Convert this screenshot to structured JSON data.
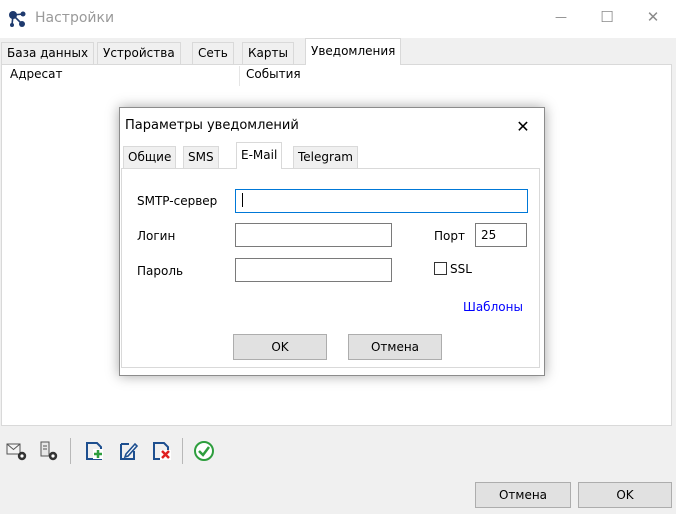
{
  "window": {
    "title": "Настройки",
    "controls": {
      "minimize": "—",
      "maximize": "☐",
      "close": "✕"
    }
  },
  "tabs": [
    {
      "label": "База данных"
    },
    {
      "label": "Устройства"
    },
    {
      "label": "Сеть"
    },
    {
      "label": "Карты"
    },
    {
      "label": "Уведомления",
      "active": true
    }
  ],
  "list": {
    "columns": [
      "Адресат",
      "События"
    ]
  },
  "toolbar": {
    "icons": [
      "mail-settings-icon",
      "device-settings-icon",
      "add-icon",
      "edit-icon",
      "delete-icon",
      "check-icon"
    ]
  },
  "footer": {
    "cancel_label": "Отмена",
    "ok_label": "OK"
  },
  "dialog": {
    "title": "Параметры уведомлений",
    "close": "✕",
    "tabs": [
      {
        "label": "Общие"
      },
      {
        "label": "SMS"
      },
      {
        "label": "E-Mail",
        "active": true
      },
      {
        "label": "Telegram"
      }
    ],
    "fields": {
      "smtp_label": "SMTP-сервер",
      "smtp_value": "",
      "login_label": "Логин",
      "login_value": "",
      "password_label": "Пароль",
      "password_value": "",
      "port_label": "Порт",
      "port_value": "25",
      "ssl_label": "SSL",
      "ssl_checked": false
    },
    "templates_link": "Шаблоны",
    "ok_label": "OK",
    "cancel_label": "Отмена"
  },
  "colors": {
    "accent": "#0078d7",
    "link": "#0000ff",
    "check_green": "#2e9e3e",
    "delete_red": "#e02020",
    "icon_blue": "#1e4f8f"
  }
}
